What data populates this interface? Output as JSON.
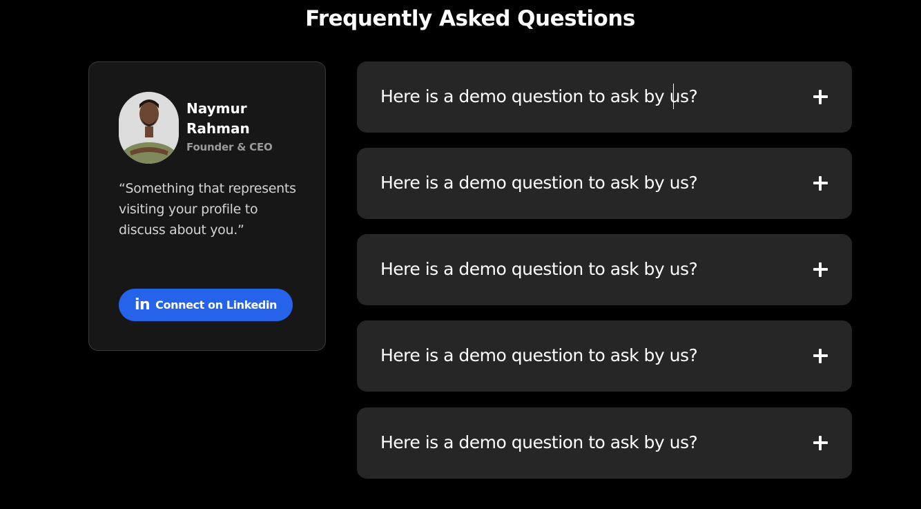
{
  "page": {
    "title": "Frequently Asked Questions"
  },
  "profile": {
    "name": "Naymur Rahman",
    "role": "Founder & CEO",
    "quote": "“Something that represents visiting your profile to discuss about you.”",
    "linkedin_icon_text": "in",
    "linkedin_label": "Connect on Linkedin",
    "button_color": "#2563eb"
  },
  "faq": {
    "items": [
      {
        "question": "Here is a demo question to ask by us?",
        "icon": "plus-icon",
        "expanded": false
      },
      {
        "question": "Here is a demo question to ask by us?",
        "icon": "plus-icon",
        "expanded": false
      },
      {
        "question": "Here is a demo question to ask by us?",
        "icon": "plus-icon",
        "expanded": false
      },
      {
        "question": "Here is a demo question to ask by us?",
        "icon": "plus-icon",
        "expanded": false
      },
      {
        "question": "Here is a demo question to ask by us?",
        "icon": "plus-icon",
        "expanded": false
      }
    ]
  }
}
